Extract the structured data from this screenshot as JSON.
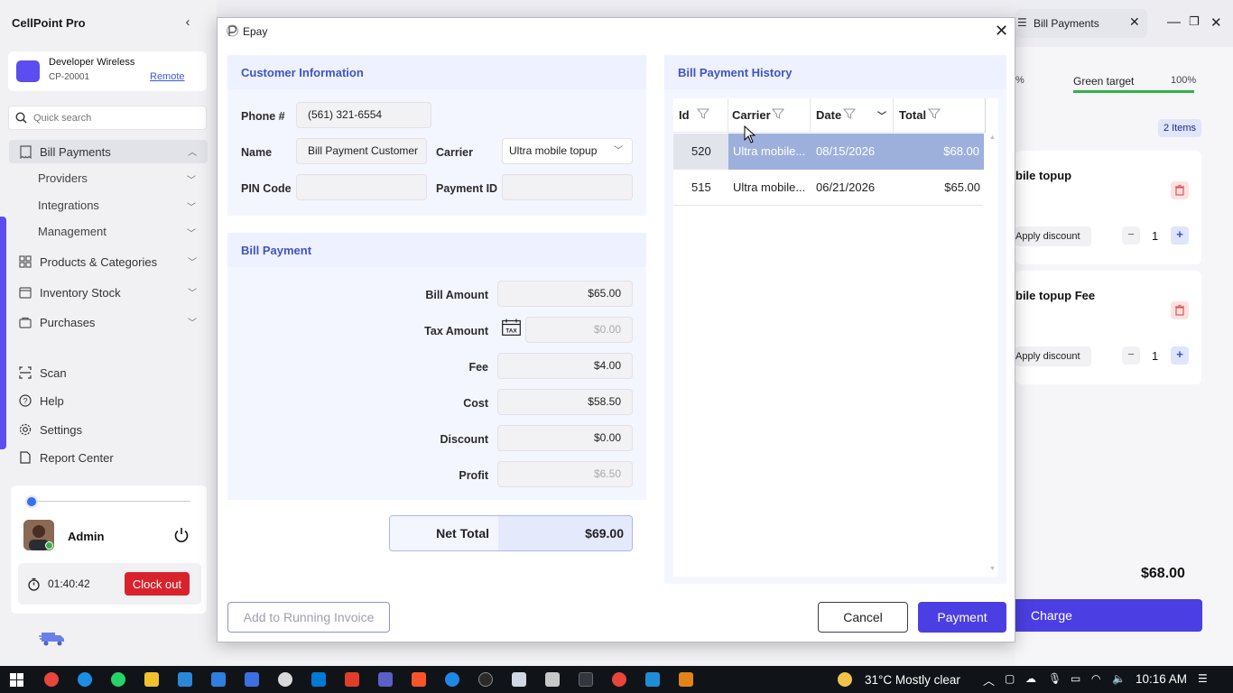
{
  "app": {
    "title": "CellPoint Pro"
  },
  "store": {
    "name": "Developer Wireless",
    "id": "CP-20001",
    "mode": "Remote"
  },
  "search": {
    "placeholder": "Quick search"
  },
  "nav": {
    "bill_payments": "Bill Payments",
    "providers": "Providers",
    "integrations": "Integrations",
    "management": "Management",
    "products": "Products & Categories",
    "inventory": "Inventory Stock",
    "purchases": "Purchases",
    "scan": "Scan",
    "help": "Help",
    "settings": "Settings",
    "report_center": "Report Center"
  },
  "user": {
    "name": "Admin",
    "timer": "01:40:42",
    "clock_out": "Clock out"
  },
  "background": {
    "tab_label": "Bill Payments",
    "target_label": "Green target",
    "target_pct": "100%",
    "target_prev_pct": "%",
    "target_progress": 1.0,
    "items_badge": "2 Items",
    "cart": [
      {
        "name": "bile topup",
        "apply_discount": "Apply discount",
        "qty": "1"
      },
      {
        "name": "bile topup Fee",
        "apply_discount": "Apply discount",
        "qty": "1"
      }
    ],
    "total": "$68.00",
    "charge": "Charge"
  },
  "dialog": {
    "title": "Epay",
    "customer": {
      "section_title": "Customer Information",
      "phone_label": "Phone #",
      "phone_value": "(561) 321-6554",
      "name_label": "Name",
      "name_value": "Bill Payment Customer",
      "carrier_label": "Carrier",
      "carrier_value": "Ultra mobile topup",
      "pin_label": "PIN Code",
      "pin_value": "",
      "payment_id_label": "Payment ID",
      "payment_id_value": ""
    },
    "bill": {
      "section_title": "Bill Payment",
      "bill_amount_label": "Bill Amount",
      "bill_amount": "$65.00",
      "tax_label": "Tax Amount",
      "tax_amount": "$0.00",
      "fee_label": "Fee",
      "fee": "$4.00",
      "cost_label": "Cost",
      "cost": "$58.50",
      "discount_label": "Discount",
      "discount": "$0.00",
      "profit_label": "Profit",
      "profit": "$6.50",
      "net_total_label": "Net Total",
      "net_total": "$69.00"
    },
    "history": {
      "section_title": "Bill Payment History",
      "columns": [
        "Id",
        "Carrier",
        "Date",
        "Total"
      ],
      "rows": [
        {
          "id": "520",
          "carrier": "Ultra mobile...",
          "date": "08/15/2026",
          "total": "$68.00"
        },
        {
          "id": "515",
          "carrier": "Ultra mobile...",
          "date": "06/21/2026",
          "total": "$65.00"
        }
      ]
    },
    "buttons": {
      "add_to_invoice": "Add to Running Invoice",
      "cancel": "Cancel",
      "payment": "Payment"
    }
  },
  "taskbar": {
    "weather": "31°C  Mostly clear",
    "time": "10:16 AM"
  },
  "colors": {
    "accent": "#4b3fe3",
    "section_title": "#3f55c4",
    "clock_out": "#d9232c",
    "selected_row": "#9db0dc"
  }
}
